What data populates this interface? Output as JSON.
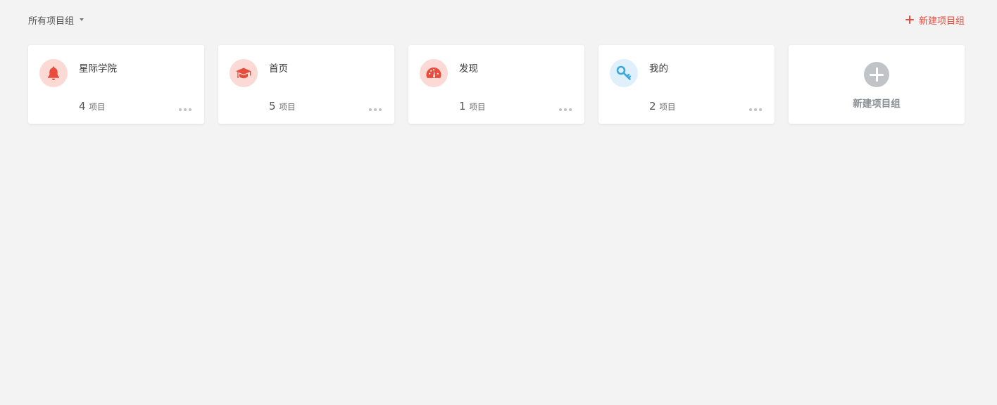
{
  "header": {
    "filter_label": "所有项目组",
    "new_group_label": "新建项目组"
  },
  "colors": {
    "accent_red": "#e84c3d",
    "red_bg": "#fbdad6",
    "blue": "#3aa8dd",
    "blue_bg": "#dff0fa",
    "gray_plus": "#c0c4c7"
  },
  "groups": [
    {
      "name": "星际学院",
      "count": "4",
      "unit": "项目",
      "icon": "bell-icon"
    },
    {
      "name": "首页",
      "count": "5",
      "unit": "项目",
      "icon": "graduation-cap-icon"
    },
    {
      "name": "发现",
      "count": "1",
      "unit": "项目",
      "icon": "dashboard-icon"
    },
    {
      "name": "我的",
      "count": "2",
      "unit": "项目",
      "icon": "key-icon"
    }
  ],
  "new_card": {
    "label": "新建项目组",
    "icon": "plus-circle-icon"
  }
}
